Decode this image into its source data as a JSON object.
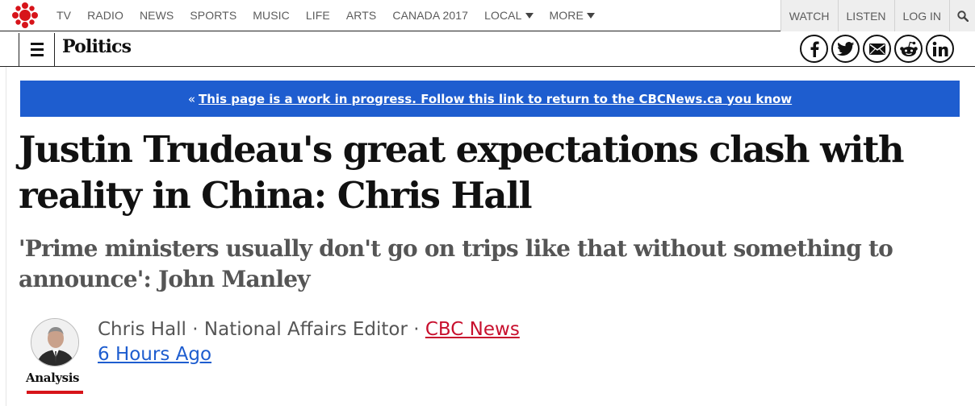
{
  "nav": {
    "links": [
      {
        "label": "TV"
      },
      {
        "label": "RADIO"
      },
      {
        "label": "NEWS"
      },
      {
        "label": "SPORTS"
      },
      {
        "label": "MUSIC"
      },
      {
        "label": "LIFE"
      },
      {
        "label": "ARTS"
      },
      {
        "label": "CANADA 2017"
      },
      {
        "label": "LOCAL",
        "dropdown": true
      },
      {
        "label": "MORE",
        "dropdown": true
      }
    ],
    "right": {
      "watch": "WATCH",
      "listen": "LISTEN",
      "login": "LOG IN"
    }
  },
  "section": {
    "title": "Politics"
  },
  "banner": {
    "prefix": "«",
    "link_text": "This page is a work in progress. Follow this link to return to the CBCNews.ca you know",
    "color": "#1e5dcf"
  },
  "article": {
    "headline": "Justin Trudeau's great expectations clash with reality in China: Chris Hall",
    "deck": "'Prime ministers usually don't go on trips like that without something to announce': John Manley",
    "label": "Analysis",
    "byline": {
      "author": "Chris Hall",
      "role": "National Affairs Editor",
      "separator": " · ",
      "source": "CBC News"
    },
    "timestamp": "6 Hours Ago"
  },
  "colors": {
    "brand_red": "#d7141a",
    "link_blue": "#1e5dcf"
  },
  "icons": [
    "cbc-gem-logo-icon",
    "search-icon",
    "menu-icon",
    "facebook-icon",
    "twitter-icon",
    "email-icon",
    "reddit-icon",
    "linkedin-icon"
  ]
}
